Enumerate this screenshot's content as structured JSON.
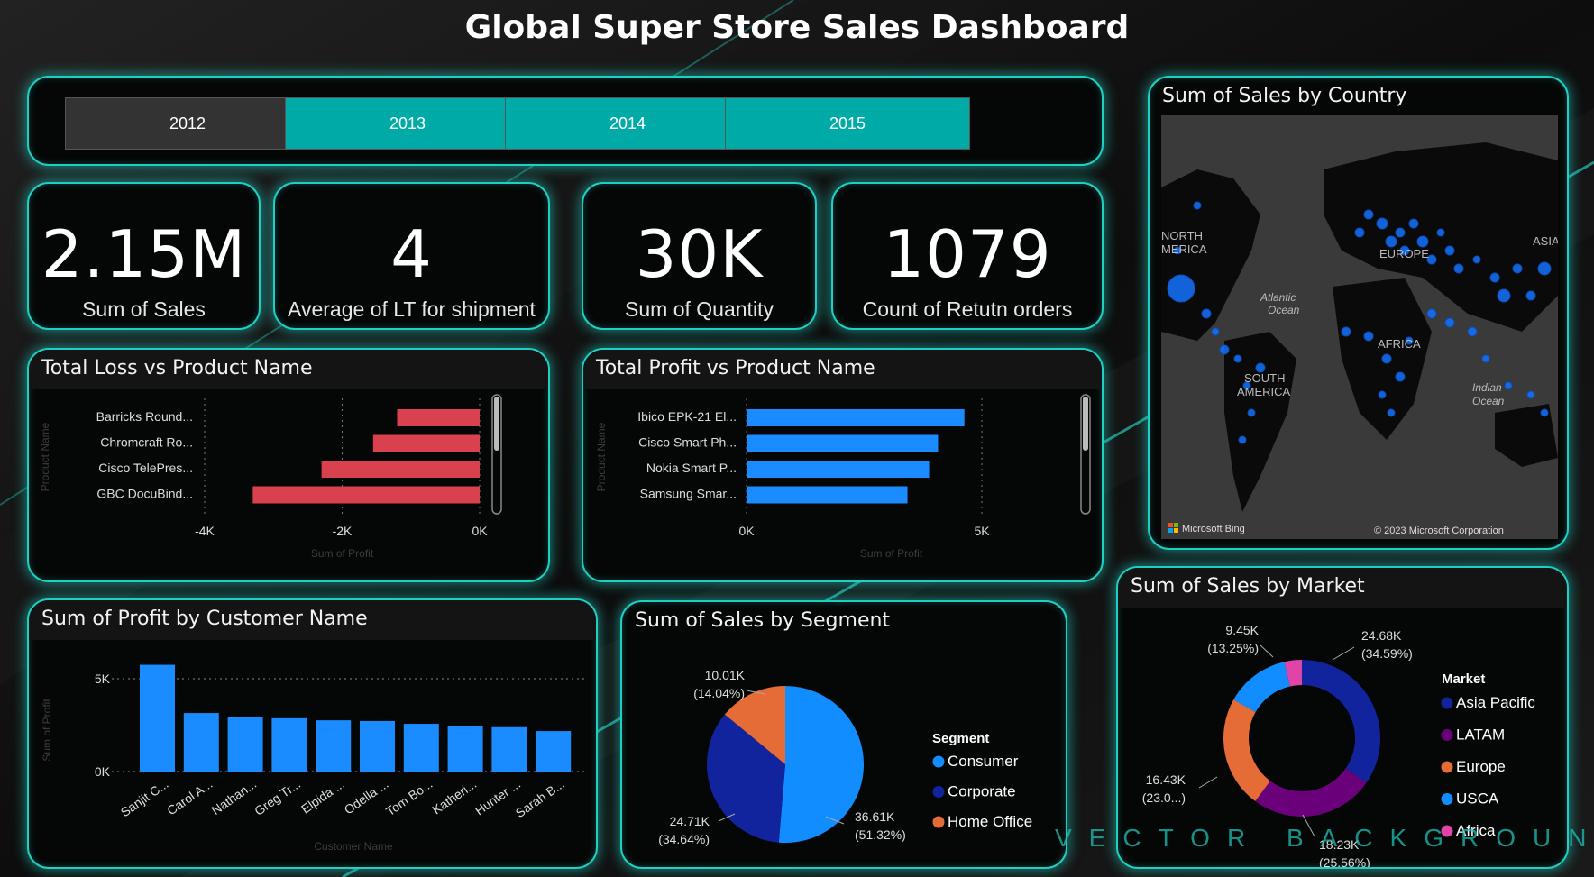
{
  "dashboard_title": "Global Super Store Sales Dashboard",
  "colors": {
    "accent": "#1fcfc3",
    "slicer_active": "#00aaa6",
    "slicer_inactive": "#333333",
    "loss_bar": "#d9414e",
    "profit_bar": "#1a8cff",
    "consumer": "#118dff",
    "corporate": "#12239e",
    "home_office": "#e66c37",
    "latam": "#6b007b",
    "africa": "#e044a7"
  },
  "year_slicer": {
    "options": [
      {
        "label": "2012",
        "selected": false
      },
      {
        "label": "2013",
        "selected": true
      },
      {
        "label": "2014",
        "selected": true
      },
      {
        "label": "2015",
        "selected": true
      }
    ]
  },
  "kpis": [
    {
      "value": "2.15M",
      "label": "Sum of Sales"
    },
    {
      "value": "4",
      "label": "Average of LT for shipment"
    },
    {
      "value": "30K",
      "label": "Sum of Quantity"
    },
    {
      "value": "1079",
      "label": "Count of Retutn orders"
    }
  ],
  "map": {
    "title": "Sum of Sales by Country",
    "labels": [
      "NORTH",
      "MERICA",
      "EUROPE",
      "ASIA",
      "Atlantic",
      "Ocean",
      "AFRICA",
      "SOUTH",
      "AMERICA",
      "Indian",
      "Ocean"
    ],
    "attribution_left": "Microsoft Bing",
    "attribution_right": "© 2023 Microsoft Corporation"
  },
  "watermark": "VECTOR BACKGROUND",
  "chart_data": [
    {
      "type": "bar",
      "orientation": "horizontal",
      "title": "Total Loss vs Product Name",
      "ylabel": "Product Name",
      "xlabel": "Sum of Profit",
      "categories": [
        "Barricks Round...",
        "Chromcraft Ro...",
        "Cisco TelePres...",
        "GBC DocuBind..."
      ],
      "values": [
        -1200,
        -1550,
        -2300,
        -3300
      ],
      "xlim": [
        -4000,
        0
      ],
      "xticks": [
        "-4K",
        "-2K",
        "0K"
      ],
      "grid": true
    },
    {
      "type": "bar",
      "orientation": "horizontal",
      "title": "Total Profit vs Product Name",
      "ylabel": "Product Name",
      "xlabel": "Sum of Profit",
      "categories": [
        "Ibico EPK-21 El...",
        "Cisco Smart Ph...",
        "Nokia Smart P...",
        "Samsung Smar..."
      ],
      "values": [
        4630,
        4070,
        3880,
        3420
      ],
      "xlim": [
        0,
        5000
      ],
      "xticks": [
        "0K",
        "5K"
      ],
      "grid": true
    },
    {
      "type": "bar",
      "title": "Sum of Profit by Customer Name",
      "ylabel": "Sum of Profit",
      "xlabel": "Customer Name",
      "categories": [
        "Sanjit C...",
        "Carol A...",
        "Nathan...",
        "Greg Tr...",
        "Elpida ...",
        "Odella ...",
        "Tom Bo...",
        "Katheri...",
        "Hunter ...",
        "Sarah B..."
      ],
      "values": [
        5750,
        3150,
        2950,
        2870,
        2760,
        2720,
        2570,
        2470,
        2390,
        2180
      ],
      "ylim": [
        0,
        5000
      ],
      "yticks": [
        "5K",
        "0K"
      ],
      "grid": true
    },
    {
      "type": "pie",
      "title": "Sum of Sales by Segment",
      "legend_title": "Segment",
      "legend_position": "right",
      "series": [
        {
          "name": "Consumer",
          "value": 36.61,
          "label": "36.61K",
          "pct": "(51.32%)"
        },
        {
          "name": "Corporate",
          "value": 24.71,
          "label": "24.71K",
          "pct": "(34.64%)"
        },
        {
          "name": "Home Office",
          "value": 10.01,
          "label": "10.01K",
          "pct": "(14.04%)"
        }
      ],
      "unit": "K"
    },
    {
      "type": "pie",
      "style": "donut",
      "title": "Sum of Sales by Market",
      "legend_title": "Market",
      "legend_position": "right",
      "series": [
        {
          "name": "Asia Pacific",
          "value": 24.68,
          "label": "24.68K",
          "pct": "(34.59%)"
        },
        {
          "name": "LATAM",
          "value": 18.23,
          "label": "18.23K",
          "pct": "(25.56%)"
        },
        {
          "name": "Europe",
          "value": 16.43,
          "label": "16.43K",
          "pct": "(23.0...)"
        },
        {
          "name": "USCA",
          "value": 9.45,
          "label": "9.45K",
          "pct": "(13.25%)"
        },
        {
          "name": "Africa",
          "value": 2.56,
          "label": "",
          "pct": ""
        }
      ],
      "unit": "K"
    }
  ]
}
